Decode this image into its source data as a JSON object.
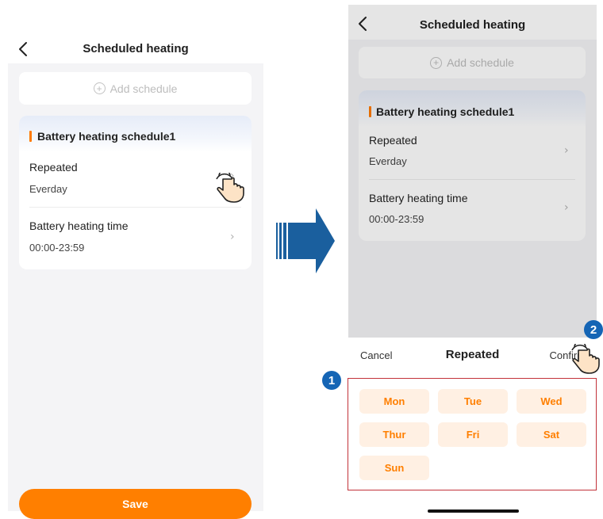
{
  "left_screen": {
    "header": {
      "title": "Scheduled heating"
    },
    "add_schedule_label": "Add schedule",
    "schedule_card": {
      "title": "Battery heating schedule1",
      "repeated": {
        "label": "Repeated",
        "value": "Everday"
      },
      "heating_time": {
        "label": "Battery heating time",
        "value": "00:00-23:59"
      }
    },
    "save_label": "Save"
  },
  "right_screen": {
    "header": {
      "title": "Scheduled heating"
    },
    "add_schedule_label": "Add schedule",
    "schedule_card": {
      "title": "Battery heating schedule1",
      "repeated": {
        "label": "Repeated",
        "value": "Everday"
      },
      "heating_time": {
        "label": "Battery heating time",
        "value": "00:00-23:59"
      }
    },
    "sheet": {
      "cancel_label": "Cancel",
      "title": "Repeated",
      "confirm_label": "Confirm",
      "days": [
        "Mon",
        "Tue",
        "Wed",
        "Thur",
        "Fri",
        "Sat",
        "Sun"
      ]
    }
  },
  "steps": {
    "one": "1",
    "two": "2"
  },
  "colors": {
    "accent": "#ff7f00",
    "day_button_bg": "#fff0e3",
    "highlight_box": "#c2323a",
    "step_badge": "#1565b5",
    "arrow": "#1a5f9e"
  },
  "icons": {
    "back": "chevron-left-icon",
    "add": "plus-circle-icon",
    "row_arrow": "chevron-right-icon",
    "tap_hand": "tap-hand-icon",
    "transition_arrow": "arrow-right-icon"
  }
}
